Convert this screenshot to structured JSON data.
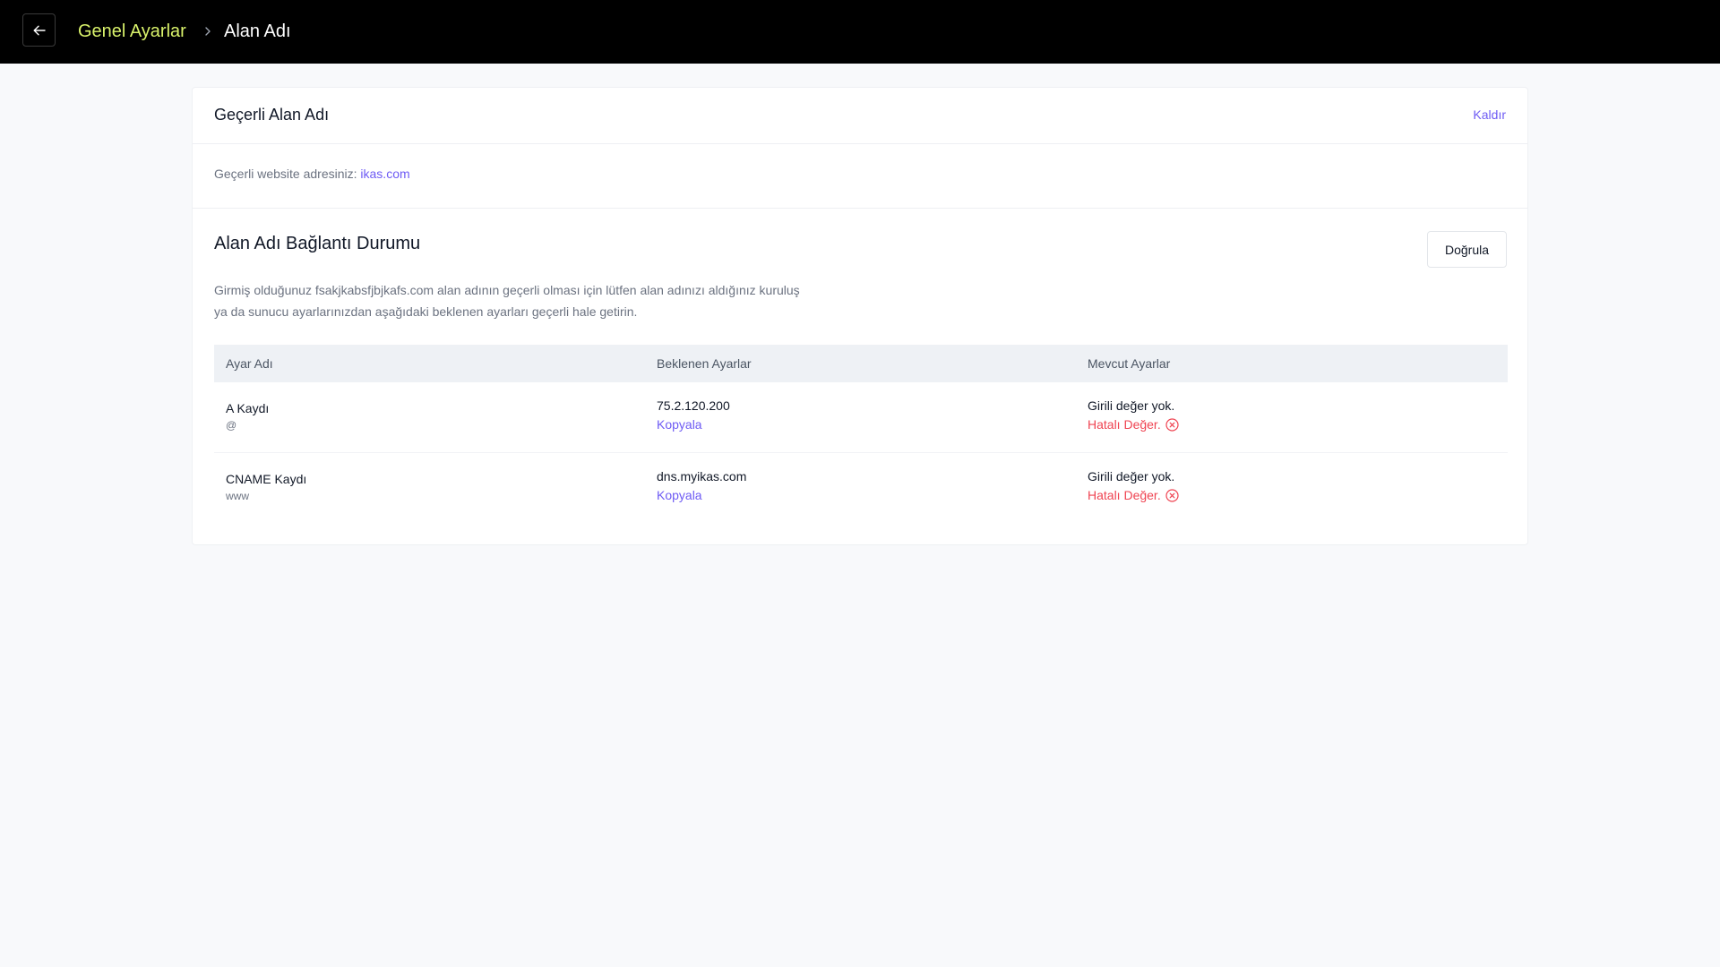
{
  "header": {
    "back_icon": "arrow-left-icon",
    "breadcrumb_parent": "Genel Ayarlar",
    "breadcrumb_separator_icon": "chevron-right-icon",
    "breadcrumb_current": "Alan Adı"
  },
  "current_domain": {
    "title": "Geçerli Alan Adı",
    "remove_label": "Kaldır",
    "label": "Geçerli website adresiniz:",
    "domain": "ikas.com"
  },
  "connection": {
    "title": "Alan Adı Bağlantı Durumu",
    "verify_label": "Doğrula",
    "description_line1": "Girmiş olduğunuz fsakjkabsfjbjkafs.com alan adının geçerli olması için lütfen alan adınızı aldığınız kuruluş",
    "description_line2": "ya da sunucu ayarlarınızdan aşağıdaki beklenen ayarları geçerli hale getirin."
  },
  "table": {
    "headers": [
      "Ayar Adı",
      "Beklenen Ayarlar",
      "Mevcut Ayarlar"
    ],
    "rows": [
      {
        "name": "A Kaydı",
        "host": "@",
        "expected": "75.2.120.200",
        "copy_label": "Kopyala",
        "current": "Girili değer yok.",
        "status": "Hatalı Değer.",
        "status_icon": "x-circle-icon"
      },
      {
        "name": "CNAME Kaydı",
        "host": "www",
        "expected": "dns.myikas.com",
        "copy_label": "Kopyala",
        "current": "Girili değer yok.",
        "status": "Hatalı Değer.",
        "status_icon": "x-circle-icon"
      }
    ]
  },
  "colors": {
    "accent": "#6e5bf4",
    "breadcrumb_parent": "#d9f26b",
    "error": "#ef4452",
    "topbar": "#000000"
  }
}
